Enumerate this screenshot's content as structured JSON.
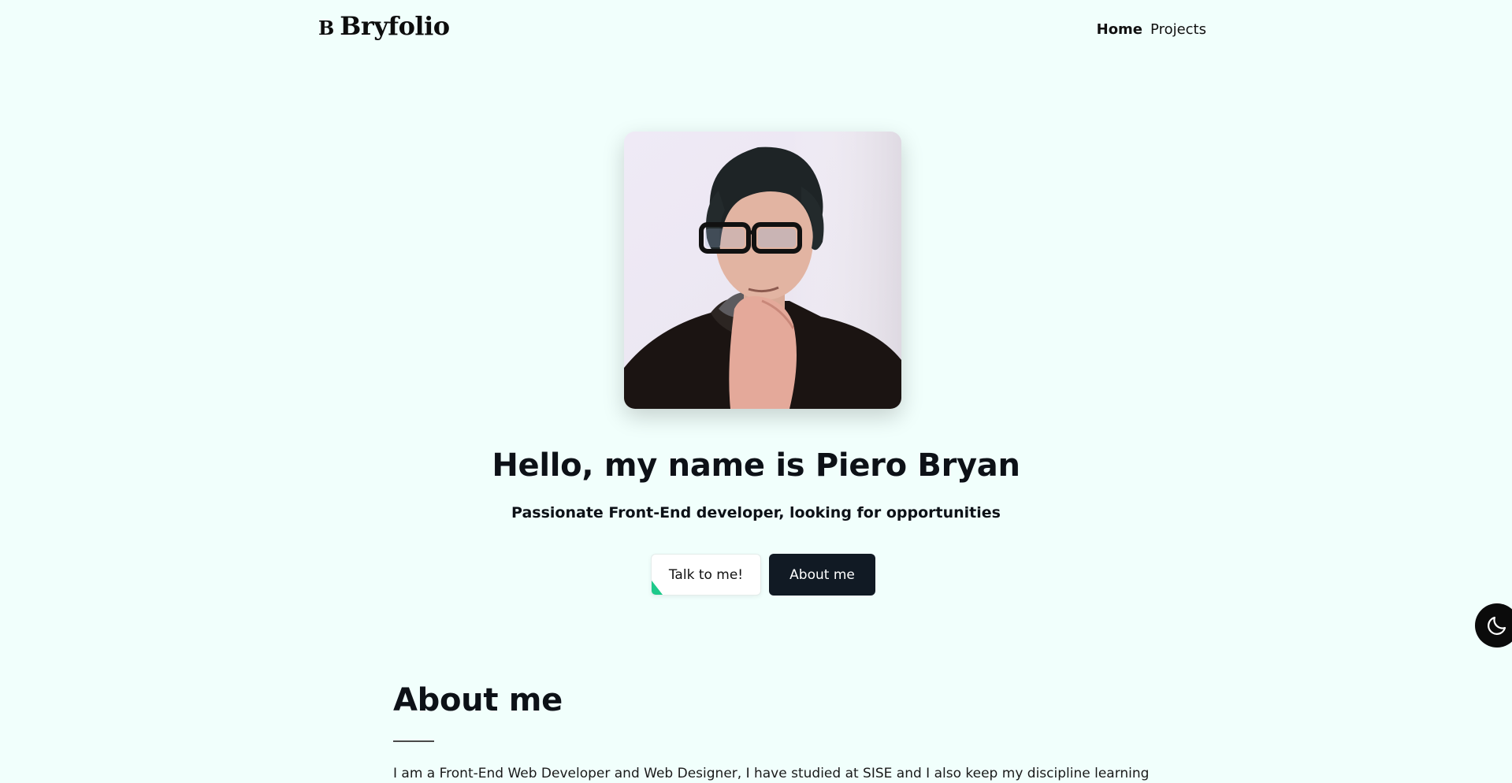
{
  "header": {
    "logo_mark": "B",
    "logo_text": "Bryfolio",
    "nav": [
      {
        "label": "Home",
        "active": true
      },
      {
        "label": "Projects",
        "active": false
      }
    ]
  },
  "hero": {
    "title": "Hello, my name is Piero Bryan",
    "subtitle": "Passionate Front-End developer, looking for opportunities",
    "buttons": {
      "talk_label": "Talk to me!",
      "about_label": "About me"
    }
  },
  "theme_toggle": {
    "icon": "moon-icon"
  },
  "about": {
    "title": "About me",
    "text": "I am a Front-End Web Developer and Web Designer, I have studied at SISE and I also keep my discipline learning"
  },
  "colors": {
    "background": "#f1fffc",
    "accent": "#1ec98a",
    "dark_button": "#111a24"
  }
}
